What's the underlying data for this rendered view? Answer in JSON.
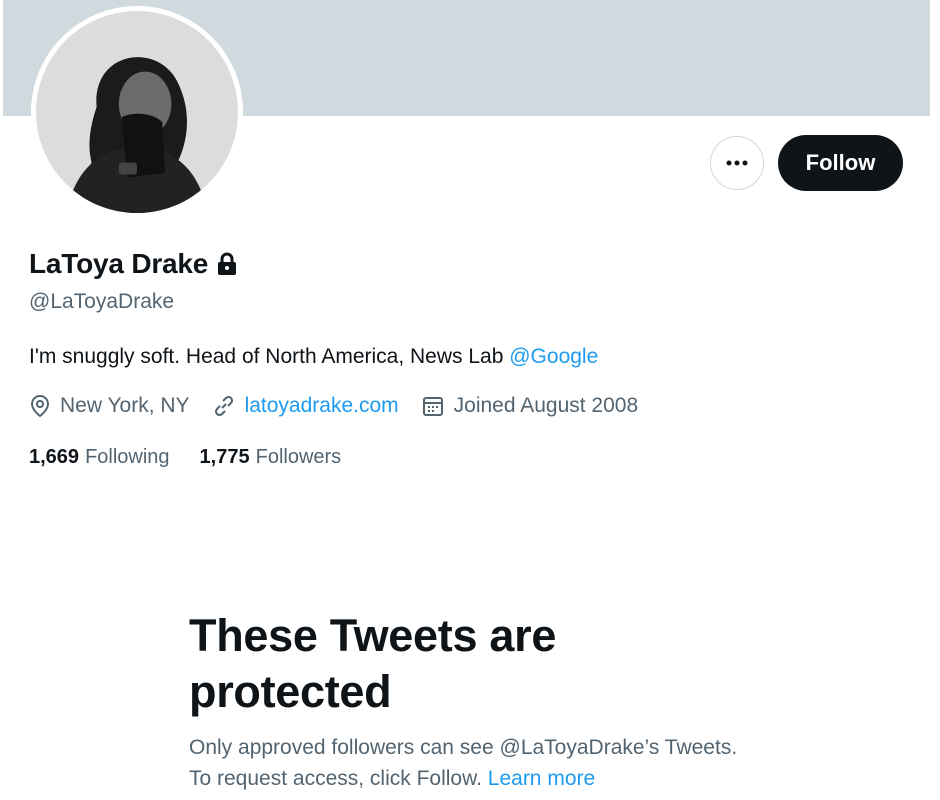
{
  "profile": {
    "name": "LaToya Drake",
    "handle": "@LaToyaDrake",
    "bio_text": "I'm snuggly soft. Head of North America, News Lab ",
    "bio_mention": "@Google",
    "location": "New York, NY",
    "website": "latoyadrake.com",
    "joined": "Joined August 2008",
    "following_count": "1,669",
    "following_label": "Following",
    "followers_count": "1,775",
    "followers_label": "Followers",
    "protected": true
  },
  "actions": {
    "follow_label": "Follow",
    "more_icon": "more-horizontal-icon"
  },
  "protected_notice": {
    "title": "These Tweets are protected",
    "body": "Only approved followers can see @LaToyaDrake’s Tweets. To request access, click Follow. ",
    "learn_more": "Learn more"
  },
  "colors": {
    "banner": "#cfd9de",
    "link": "#1d9bf0",
    "primary_text": "#0f1419",
    "secondary_text": "#536471",
    "follow_button": "#0f1419"
  }
}
